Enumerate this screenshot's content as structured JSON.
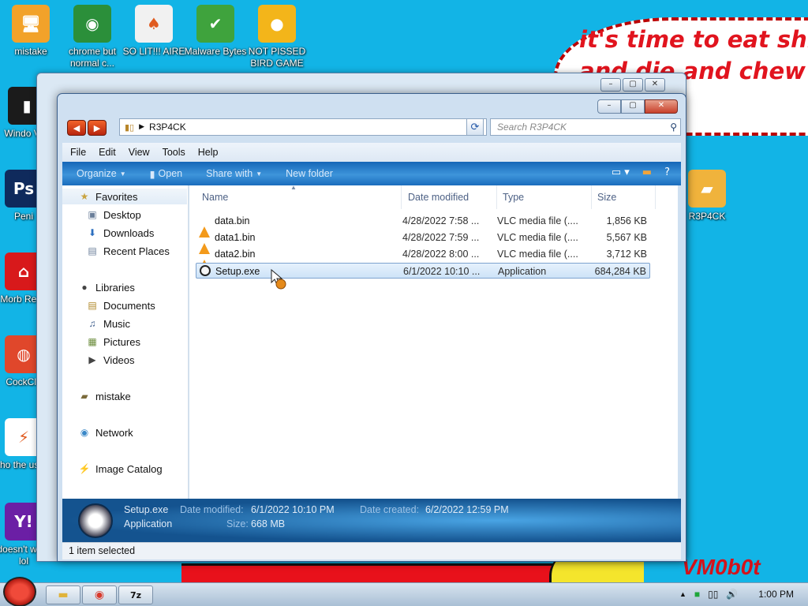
{
  "desktop": {
    "icons": [
      {
        "label": "mistake",
        "icon": "computer-icon",
        "color": "#f2a22a"
      },
      {
        "label": "chrome but normal c...",
        "icon": "chrome-icon",
        "color": "#2b8f3a"
      },
      {
        "label": "SO LIT!!! AIRE",
        "icon": "cards-icon",
        "color": "#f1f1f1"
      },
      {
        "label": "Malware Bytes",
        "icon": "shield-icon",
        "color": "#3fa33d"
      },
      {
        "label": "NOT PISSED BIRD GAME",
        "icon": "bird-icon",
        "color": "#f3b51a"
      },
      {
        "label": "Windo Vist",
        "icon": "trash-icon",
        "color": "#1b1b1b"
      },
      {
        "label": "Peni",
        "icon": "ps-icon",
        "color": "#0f2a5c"
      },
      {
        "label": "Morb Read",
        "icon": "pdf-icon",
        "color": "#d8191b"
      },
      {
        "label": "CockCle",
        "icon": "cleaner-icon",
        "color": "#e0472b"
      },
      {
        "label": "who the uses t",
        "icon": "lightning-icon",
        "color": "#ffffff"
      },
      {
        "label": "doesn't work lol",
        "icon": "yahoo-icon",
        "color": "#6b1fa5"
      },
      {
        "label": "R3P4CK",
        "icon": "folder-icon",
        "color": "#f0b33c"
      }
    ],
    "speech_text": "it's time to eat shi\nand die and chew\num",
    "watermark": "VM0b0t"
  },
  "window": {
    "address_path": "R3P4CK",
    "search_placeholder": "Search R3P4CK",
    "menu": [
      "File",
      "Edit",
      "View",
      "Tools",
      "Help"
    ],
    "commands": [
      {
        "label": "Organize",
        "dropdown": true
      },
      {
        "label": "Open",
        "dropdown": false
      },
      {
        "label": "Share with",
        "dropdown": true
      },
      {
        "label": "New folder",
        "dropdown": false
      }
    ],
    "nav": {
      "favorites": {
        "label": "Favorites",
        "items": [
          "Desktop",
          "Downloads",
          "Recent Places"
        ]
      },
      "libraries": {
        "label": "Libraries",
        "items": [
          "Documents",
          "Music",
          "Pictures",
          "Videos"
        ]
      },
      "user": "mistake",
      "network": "Network",
      "image_catalog": "Image Catalog"
    },
    "columns": [
      "Name",
      "Date modified",
      "Type",
      "Size"
    ],
    "files": [
      {
        "name": "data.bin",
        "date": "4/28/2022 7:58 ...",
        "type": "VLC media file (....",
        "size": "1,856 KB",
        "icon": "vlc-icon",
        "selected": false
      },
      {
        "name": "data1.bin",
        "date": "4/28/2022 7:59 ...",
        "type": "VLC media file (....",
        "size": "5,567 KB",
        "icon": "vlc-icon",
        "selected": false
      },
      {
        "name": "data2.bin",
        "date": "4/28/2022 8:00 ...",
        "type": "VLC media file (....",
        "size": "3,712 KB",
        "icon": "vlc-icon",
        "selected": false
      },
      {
        "name": "Setup.exe",
        "date": "6/1/2022 10:10 ...",
        "type": "Application",
        "size": "684,284 KB",
        "icon": "exe-icon",
        "selected": true
      }
    ],
    "details": {
      "name": "Setup.exe",
      "kind": "Application",
      "modified_label": "Date modified:",
      "modified_value": "6/1/2022 10:10 PM",
      "created_label": "Date created:",
      "created_value": "6/2/2022 12:59 PM",
      "size_label": "Size:",
      "size_value": "668 MB"
    },
    "status": "1 item selected"
  },
  "taskbar": {
    "buttons": [
      "explorer-icon",
      "chrome-icon",
      "7z-icon"
    ],
    "btn_7z": "7z",
    "clock": "1:00 PM"
  }
}
